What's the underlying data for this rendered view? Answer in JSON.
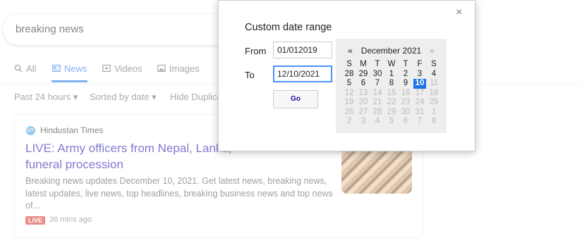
{
  "search": {
    "query": "breaking news"
  },
  "tabs": [
    {
      "label": "All",
      "icon": "search-icon"
    },
    {
      "label": "News",
      "icon": "news-icon",
      "active": true
    },
    {
      "label": "Videos",
      "icon": "video-icon"
    },
    {
      "label": "Images",
      "icon": "image-icon"
    }
  ],
  "tools": {
    "time_filter": "Past 24 hours ▾",
    "sort": "Sorted by date ▾",
    "duplicates": "Hide Duplica"
  },
  "article": {
    "source": "Hindustan Times",
    "source_icon_text": "HT",
    "headline": "LIVE: Army officers from Nepal, Lanka,",
    "headline_line2": "funeral procession",
    "snippet": "Breaking news updates December 10, 2021. Get latest news, breaking news, latest updates, live news, top headlines, breaking business news and top news of...",
    "badge": "LIVE",
    "time": "36 mins ago"
  },
  "dialog": {
    "close": "×",
    "title": "Custom date range",
    "from_label": "From",
    "from_value": "01/012019",
    "to_label": "To",
    "to_value": "12/10/2021",
    "go_label": "Go"
  },
  "calendar": {
    "prev": "«",
    "next": "»",
    "month": "December 2021",
    "weekdays": [
      "S",
      "M",
      "T",
      "W",
      "T",
      "F",
      "S"
    ],
    "weeks": [
      [
        {
          "d": "28"
        },
        {
          "d": "29"
        },
        {
          "d": "30"
        },
        {
          "d": "1"
        },
        {
          "d": "2"
        },
        {
          "d": "3"
        },
        {
          "d": "4"
        }
      ],
      [
        {
          "d": "5"
        },
        {
          "d": "6"
        },
        {
          "d": "7"
        },
        {
          "d": "8"
        },
        {
          "d": "9"
        },
        {
          "d": "10",
          "sel": true
        },
        {
          "d": "11",
          "dim": true
        }
      ],
      [
        {
          "d": "12",
          "dim": true
        },
        {
          "d": "13",
          "dim": true
        },
        {
          "d": "14",
          "dim": true
        },
        {
          "d": "15",
          "dim": true
        },
        {
          "d": "16",
          "dim": true
        },
        {
          "d": "17",
          "dim": true
        },
        {
          "d": "18",
          "dim": true
        }
      ],
      [
        {
          "d": "19",
          "dim": true
        },
        {
          "d": "20",
          "dim": true
        },
        {
          "d": "21",
          "dim": true
        },
        {
          "d": "22",
          "dim": true
        },
        {
          "d": "23",
          "dim": true
        },
        {
          "d": "24",
          "dim": true
        },
        {
          "d": "25",
          "dim": true
        }
      ],
      [
        {
          "d": "26",
          "dim": true
        },
        {
          "d": "27",
          "dim": true
        },
        {
          "d": "28",
          "dim": true
        },
        {
          "d": "29",
          "dim": true
        },
        {
          "d": "30",
          "dim": true
        },
        {
          "d": "31",
          "dim": true
        },
        {
          "d": "1",
          "dim": true
        }
      ],
      [
        {
          "d": "2",
          "dim": true
        },
        {
          "d": "3",
          "dim": true
        },
        {
          "d": "4",
          "dim": true
        },
        {
          "d": "5",
          "dim": true
        },
        {
          "d": "6",
          "dim": true
        },
        {
          "d": "7",
          "dim": true
        },
        {
          "d": "8",
          "dim": true
        }
      ]
    ]
  },
  "colors": {
    "accent": "#1a73e8",
    "link": "#1a0dab",
    "live": "#d93025"
  }
}
